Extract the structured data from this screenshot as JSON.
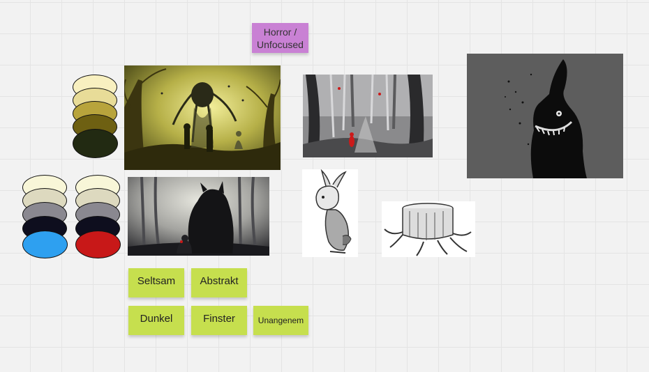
{
  "board": {
    "grid_color": "#e4e4e4",
    "background": "#f2f2f2"
  },
  "stickies": {
    "horror": {
      "text": "Horror / Unfocused",
      "color": "#c981d4"
    },
    "seltsam": {
      "text": "Seltsam",
      "color": "#c6df4e"
    },
    "abstrakt": {
      "text": "Abstrakt",
      "color": "#c6df4e"
    },
    "dunkel": {
      "text": "Dunkel",
      "color": "#c6df4e"
    },
    "finster": {
      "text": "Finster",
      "color": "#c6df4e"
    },
    "unangenem": {
      "text": "Unangenem",
      "color": "#c6df4e"
    }
  },
  "palettes": {
    "yellow": [
      "#f8f0c0",
      "#e8dc98",
      "#b8a43c",
      "#6e6012",
      "#222a12"
    ],
    "blue": [
      "#f8f6d8",
      "#ddd9bf",
      "#8a8890",
      "#0e0e1e",
      "#2ea0f0"
    ],
    "red": [
      "#f8f6d8",
      "#ddd9bf",
      "#8a8890",
      "#0e0e1e",
      "#c81818"
    ]
  },
  "images": {
    "forest_creature": "yellow-forest-creature-image",
    "werewolf": "werewolf-silhouette-image",
    "red_riding_hood": "red-riding-hood-forest-image",
    "dark_rabbit": "dark-rabbit-image",
    "rabbit_sketch": "rabbit-sketch-image",
    "tree_stump": "tree-stump-image"
  }
}
